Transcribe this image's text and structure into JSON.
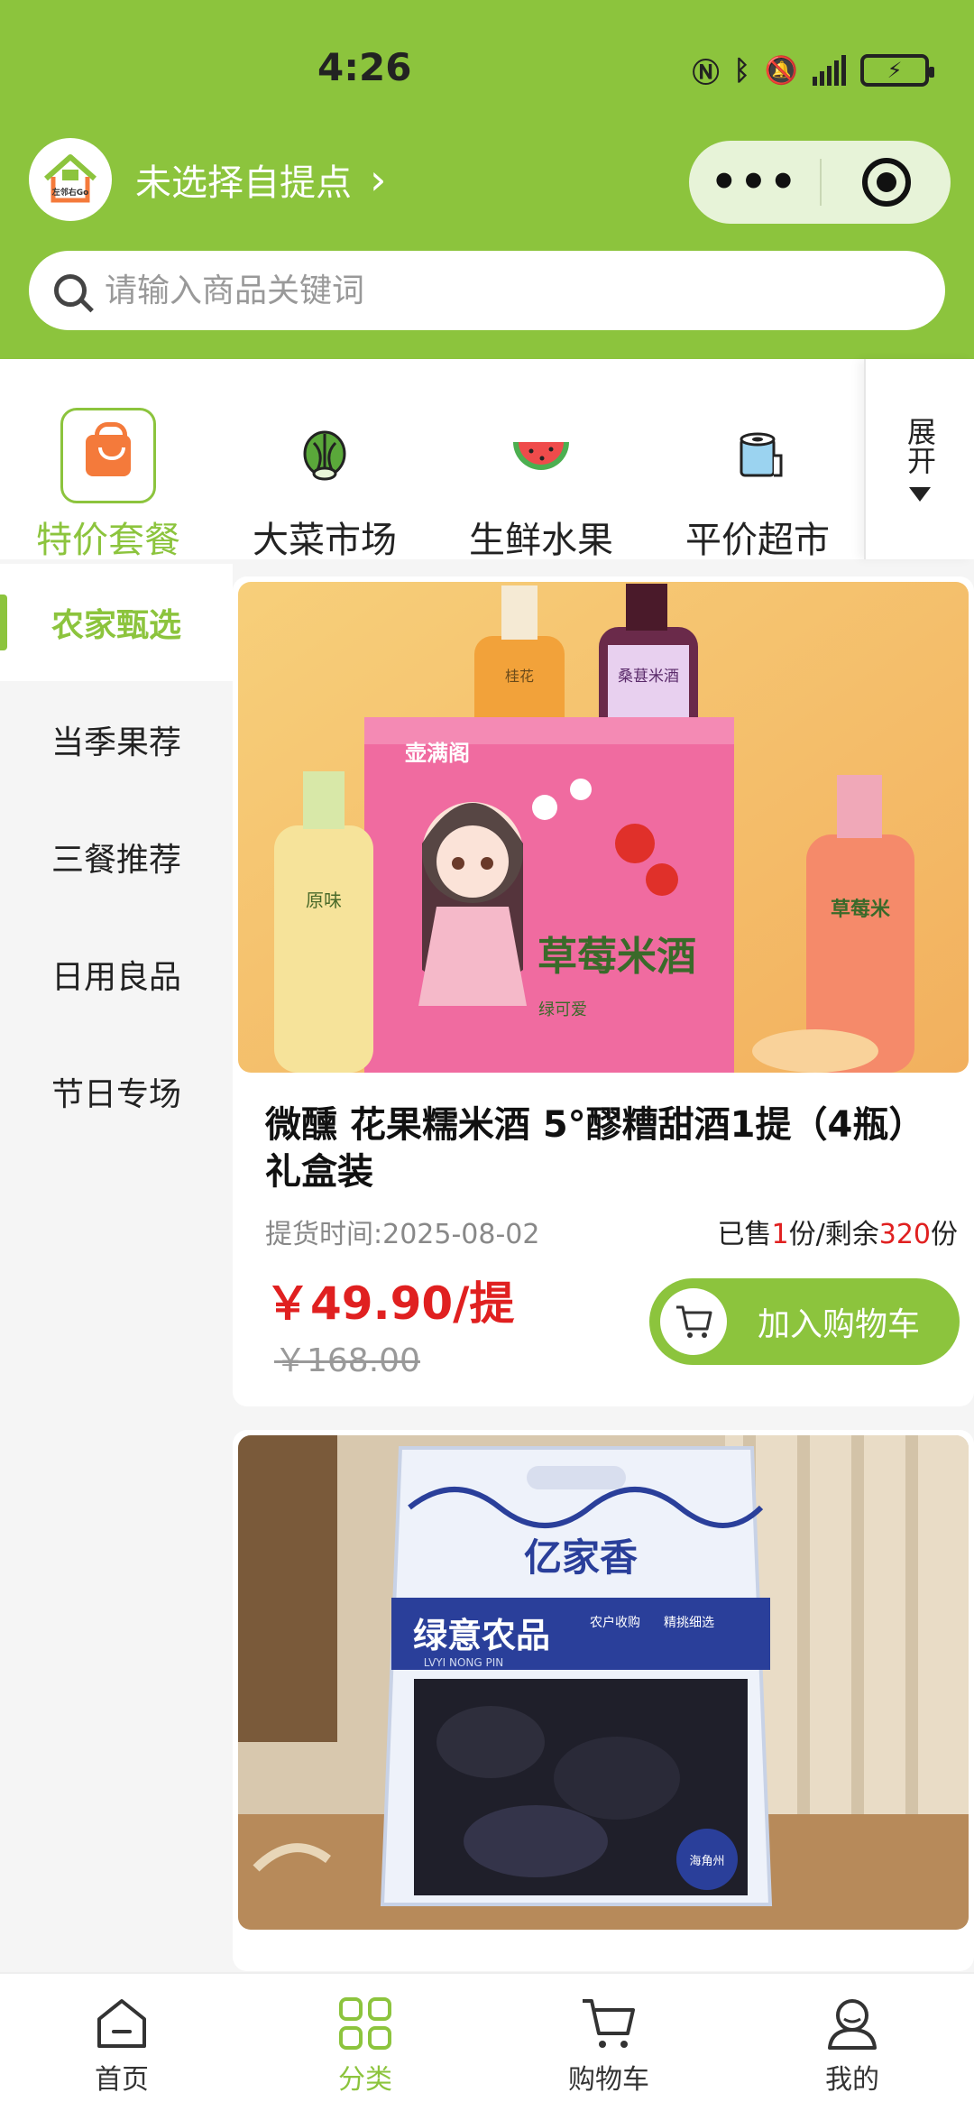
{
  "status_bar": {
    "time": "4:26"
  },
  "header": {
    "logo_text": "左邻右Go",
    "store_name": "未选择自提点",
    "capsule_more": "•••"
  },
  "search": {
    "placeholder": "请输入商品关键词"
  },
  "categories": [
    {
      "label": "特价套餐",
      "icon": "shopping-bag-icon",
      "active": true
    },
    {
      "label": "大菜市场",
      "icon": "cabbage-icon"
    },
    {
      "label": "生鲜水果",
      "icon": "watermelon-icon"
    },
    {
      "label": "平价超市",
      "icon": "paper-roll-icon"
    }
  ],
  "expand_label": "展开",
  "sidebar": {
    "items": [
      {
        "label": "农家甄选",
        "active": true
      },
      {
        "label": "当季果荐"
      },
      {
        "label": "三餐推荐"
      },
      {
        "label": "日用良品"
      },
      {
        "label": "节日专场"
      }
    ]
  },
  "products": [
    {
      "image_text": {
        "box_brand": "壶满阁",
        "box_title": "草莓米酒",
        "box_sub": "绿可爱",
        "bottle_left": "桂花",
        "bottle_top": "桑葚米酒",
        "bottle_bottom_left": "原味",
        "bottle_right": "草莓米"
      },
      "title": "微醺 花果糯米酒 5°醪糟甜酒1提（4瓶） 礼盒装",
      "pickup": "提货时间:2025-08-02",
      "sold_prefix": "已售",
      "sold_count": "1",
      "sold_mid": "份/剩余",
      "remain_count": "320",
      "sold_suffix": "份",
      "price": "￥49.90/提",
      "orig_price": "￥168.00",
      "add_cart": "加入购物车"
    },
    {
      "image_text": {
        "brand": "亿家香",
        "label": "绿意农品",
        "label_en": "LVYI NONG PIN",
        "tag1": "农户收购",
        "tag2": "精挑细选",
        "seal": "海角州"
      }
    }
  ],
  "bottom_nav": [
    {
      "label": "首页",
      "icon": "home-icon"
    },
    {
      "label": "分类",
      "icon": "grid-icon",
      "active": true
    },
    {
      "label": "购物车",
      "icon": "cart-icon"
    },
    {
      "label": "我的",
      "icon": "user-icon"
    }
  ],
  "colors": {
    "brand": "#8cc43d",
    "price": "#e02020",
    "bag": "#f47a3b"
  }
}
